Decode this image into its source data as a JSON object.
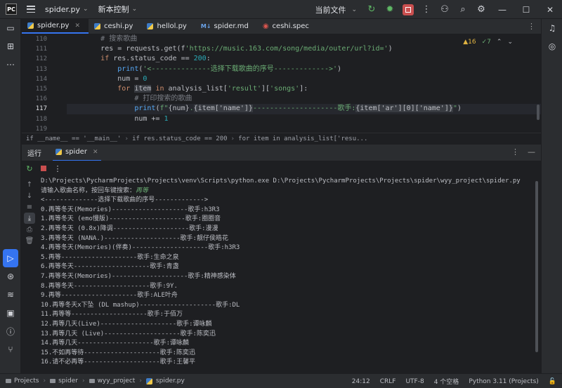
{
  "titlebar": {
    "logo": "PC",
    "project": "spider.py",
    "vcs": "新本控制",
    "run_config": "当前文件"
  },
  "tabs": [
    {
      "label": "spider.py",
      "icon": "python-file-icon",
      "active": true
    },
    {
      "label": "ceshi.py",
      "icon": "python-file-icon"
    },
    {
      "label": "hellol.py",
      "icon": "python-file-icon"
    },
    {
      "label": "spider.md",
      "icon": "markdown-file-icon",
      "prefix": "M↓"
    },
    {
      "label": "ceshi.spec",
      "icon": "spec-file-icon"
    }
  ],
  "editor": {
    "warnings": "▲16",
    "checks": "✓7",
    "line_numbers": [
      "110",
      "111",
      "112",
      "113",
      "114",
      "115",
      "116",
      "117",
      "118",
      "119"
    ],
    "current_line": "117",
    "lines": [
      {
        "indent": "        ",
        "parts": [
          {
            "t": "# 搜索歌曲",
            "c": "cmt"
          }
        ]
      },
      {
        "indent": "        ",
        "parts": [
          {
            "t": "res = requests.get(f"
          },
          {
            "t": "'https://music.163.com/song/media/outer/url?id='",
            "c": "str"
          },
          {
            "t": ")"
          }
        ]
      },
      {
        "indent": "        ",
        "parts": [
          {
            "t": "if ",
            "c": "kw"
          },
          {
            "t": "res.status_code == "
          },
          {
            "t": "200",
            "c": "num"
          },
          {
            "t": ":"
          }
        ]
      },
      {
        "indent": "            ",
        "parts": [
          {
            "t": "print",
            "c": "fn"
          },
          {
            "t": "("
          },
          {
            "t": "'<--------------选择下载歌曲的序号------------->'",
            "c": "str"
          },
          {
            "t": ")"
          }
        ]
      },
      {
        "indent": "            ",
        "parts": [
          {
            "t": "num = "
          },
          {
            "t": "0",
            "c": "num"
          }
        ]
      },
      {
        "indent": "            ",
        "parts": [
          {
            "t": "for ",
            "c": "kw"
          },
          {
            "t": "item",
            "c": "hl"
          },
          {
            "t": " in ",
            "c": "kw"
          },
          {
            "t": "analysis_list["
          },
          {
            "t": "'result'",
            "c": "str"
          },
          {
            "t": "]["
          },
          {
            "t": "'songs'",
            "c": "str"
          },
          {
            "t": "]:"
          }
        ]
      },
      {
        "indent": "                ",
        "parts": [
          {
            "t": "# 打印搜索的歌曲",
            "c": "cmt"
          }
        ]
      },
      {
        "indent": "                ",
        "parts": [
          {
            "t": "print",
            "c": "fn"
          },
          {
            "t": "("
          },
          {
            "t": "f\"",
            "c": "str"
          },
          {
            "t": "{num}"
          },
          {
            "t": ".",
            "c": "str"
          },
          {
            "t": "{item['name']}",
            "c": "hl"
          },
          {
            "t": "--------------------歌手:",
            "c": "str"
          },
          {
            "t": "{item['ar'][0]['name']}",
            "c": "hl"
          },
          {
            "t": "\"",
            "c": "str"
          },
          {
            "t": ")"
          }
        ]
      },
      {
        "indent": "                ",
        "parts": [
          {
            "t": "num += "
          },
          {
            "t": "1",
            "c": "num"
          }
        ]
      },
      {
        "indent": "",
        "parts": []
      }
    ]
  },
  "breadcrumb": [
    "if __name__ == '__main__'",
    "if res.status_code == 200",
    "for item in analysis_list['resu..."
  ],
  "run_panel": {
    "title": "运行",
    "tab": "spider"
  },
  "console": {
    "lines": [
      "D:\\Projects\\PycharmProjects\\Projects\\venv\\Scripts\\python.exe D:\\Projects\\PycharmProjects\\Projects\\spider\\wyy_project\\spider.py",
      "<--------------选择下载歌曲的序号------------->",
      "0.再等冬天(Memories)--------------------歌手:h3R3",
      "1.再等冬天 (emo慢版)--------------------歌手:圈圈音",
      "2.再等冬天 (0.8x)降调--------------------歌手:漫漫",
      "3.再等冬天 (NANA.)--------------------歌手:靓仔侯皓花",
      "4.再等冬天(Memories)(伴奏)--------------------歌手:h3R3",
      "5.再等--------------------歌手:生命之泉",
      "6.再等冬天--------------------歌手:青盏",
      "7.再等冬天(Memories)--------------------歌手:精神感染体",
      "8.再等冬天--------------------歌手:9Y.",
      "9.再等--------------------歌手:ALE叶舟",
      "10.再等冬天x下坠 (DL mashup)--------------------歌手:DL",
      "11.再等等--------------------歌手:于佰万",
      "12.再等几天(Live)--------------------歌手:谭咏麟",
      "13.再等几天 (Live)--------------------歌手:陈奕迅",
      "14.再等几天--------------------歌手:谭咏麟",
      "15.不如再等待--------------------歌手:陈奕迅",
      "16.请不必再等--------------------歌手:王馨平"
    ],
    "prompt": "请输入歌曲名称，按回车键搜索：",
    "input_value": "再等"
  },
  "statusbar": {
    "path": [
      "Projects",
      "spider",
      "wyy_project",
      "spider.py"
    ],
    "position": "24:12",
    "line_ending": "CRLF",
    "encoding": "UTF-8",
    "indent": "4 个空格",
    "interpreter": "Python 3.11 (Projects)"
  }
}
